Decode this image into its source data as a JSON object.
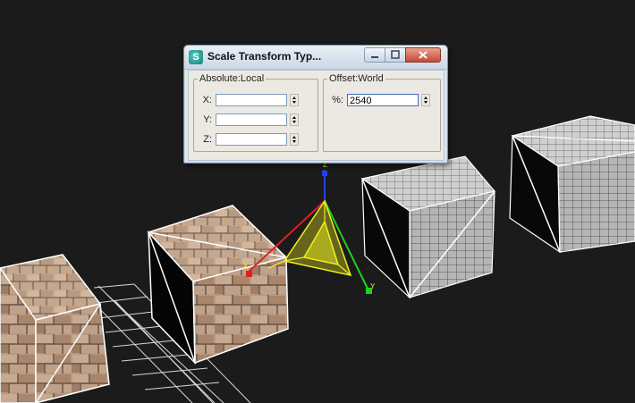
{
  "dialog": {
    "title": "Scale Transform Typ...",
    "absolute_group": {
      "label": "Absolute:Local",
      "fields": [
        {
          "label": "X:",
          "value": ""
        },
        {
          "label": "Y:",
          "value": ""
        },
        {
          "label": "Z:",
          "value": ""
        }
      ]
    },
    "offset_group": {
      "label": "Offset:World",
      "field": {
        "label": "%:",
        "value": "2540"
      }
    }
  },
  "gizmo": {
    "axis_labels": {
      "x": "X",
      "y": "Y",
      "z": "Z"
    },
    "colors": {
      "x": "#e02020",
      "y": "#20d020",
      "z": "#2040ff",
      "active": "#f0f020"
    }
  },
  "scene": {
    "background_color": "#1b1b1b",
    "objects": [
      "textured-brick-cube",
      "textured-brick-cube",
      "gray-box",
      "gray-box",
      "ground-grid"
    ]
  }
}
